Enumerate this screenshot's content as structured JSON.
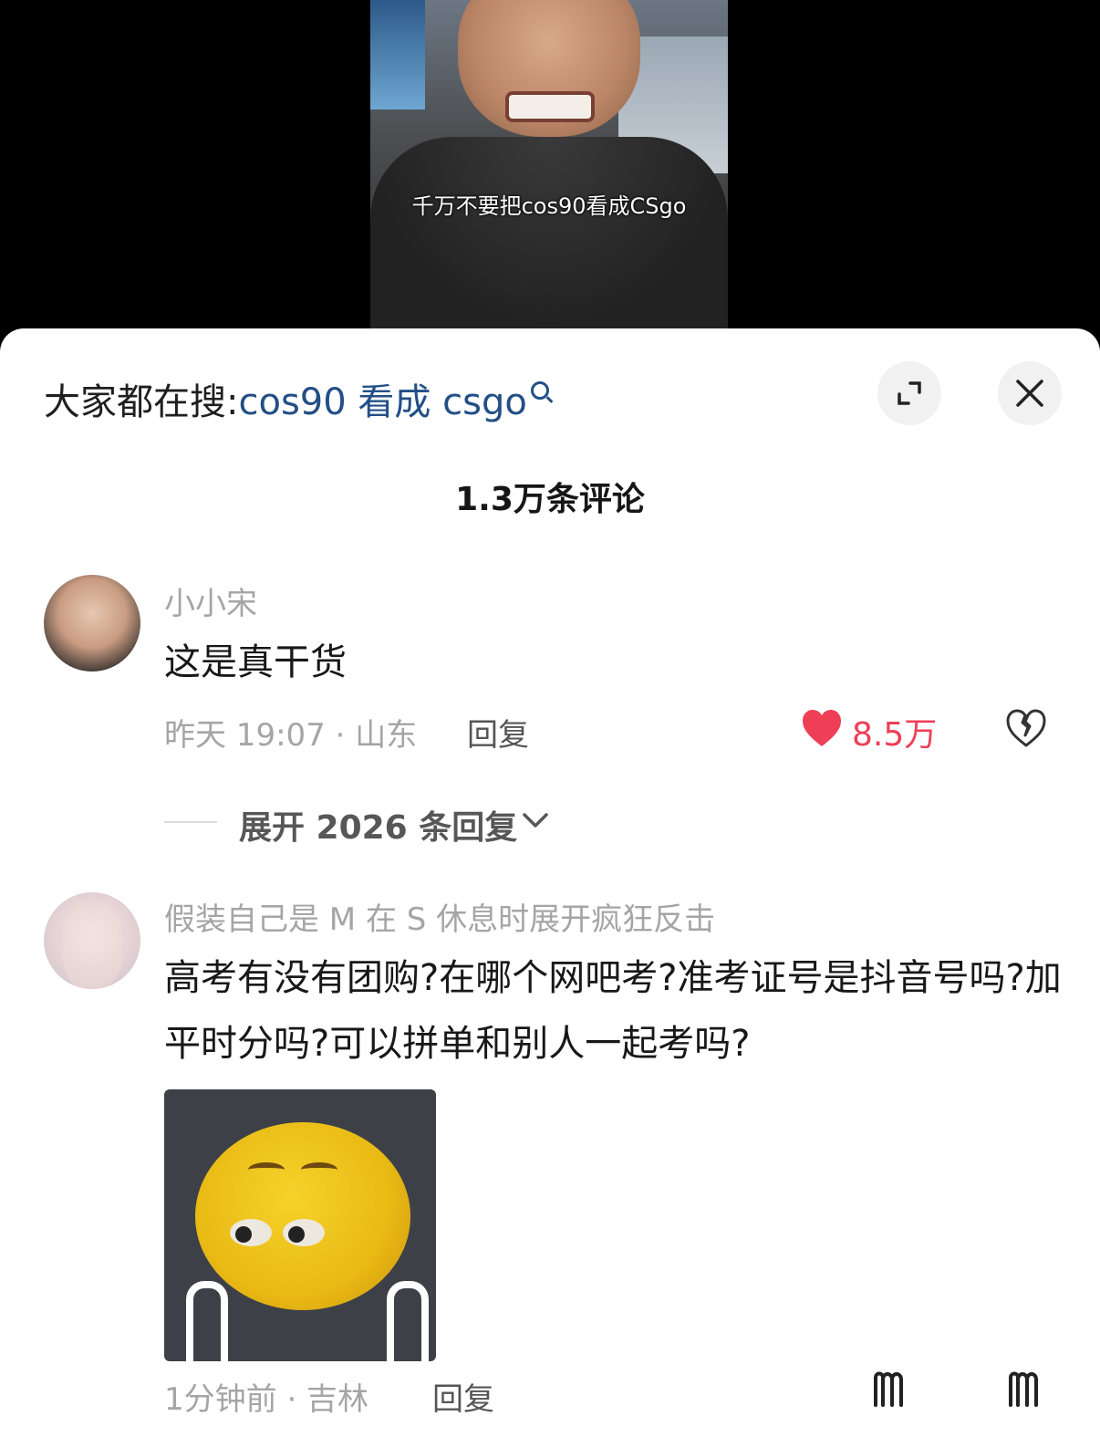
{
  "video": {
    "caption": "千万不要把cos90看成CSgo"
  },
  "search": {
    "prefix": "大家都在搜:",
    "keyword": "cos90 看成 csgo"
  },
  "header": {
    "comment_count": "1.3万条评论"
  },
  "comments": [
    {
      "username": "小小宋",
      "text": "这是真干货",
      "time_location": "昨天 19:07 · 山东",
      "reply_label": "回复",
      "likes": "8.5万",
      "expand_label": "展开 2026 条回复"
    },
    {
      "username": "假装自己是 M  在 S 休息时展开疯狂反击",
      "text": "高考有没有团购?在哪个网吧考?准考证号是抖音号吗?加平时分吗?可以拼单和别人一起考吗?",
      "time_location": "1分钟前 · 吉林",
      "reply_label": "回复"
    }
  ],
  "colors": {
    "like": "#ee3f57",
    "keyword": "#234f86"
  }
}
